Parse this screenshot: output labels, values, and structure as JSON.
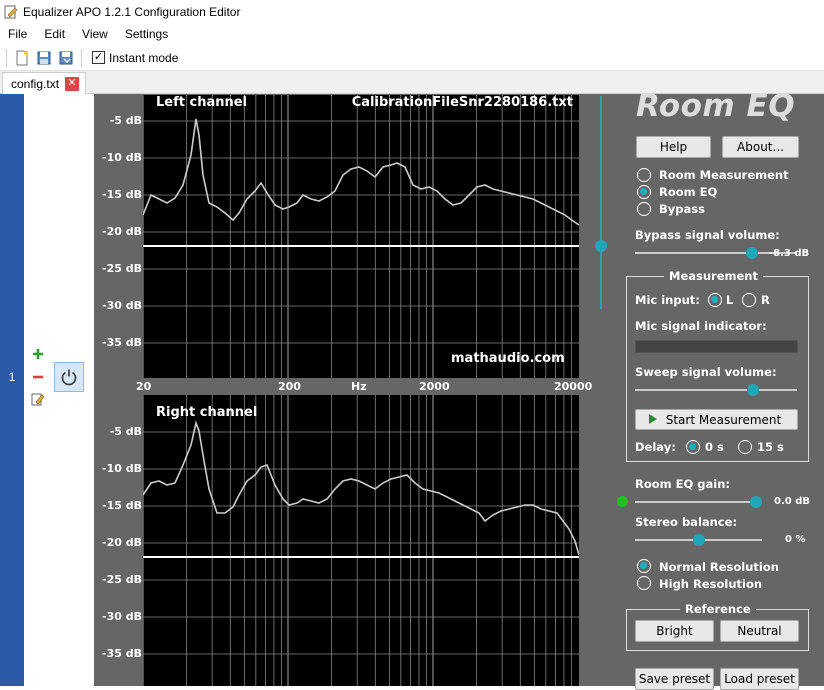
{
  "window": {
    "title": "Equalizer APO 1.2.1 Configuration Editor"
  },
  "menu": [
    "File",
    "Edit",
    "View",
    "Settings"
  ],
  "toolbar": {
    "instant_mode_label": "Instant mode",
    "instant_mode_checked": true
  },
  "tab": {
    "label": "config.txt"
  },
  "line": {
    "number": "1"
  },
  "graphs": {
    "top": {
      "label": "Left channel",
      "file": "CalibrationFileSnr2280186.txt",
      "watermark": "mathaudio.com"
    },
    "bottom": {
      "label": "Right channel"
    },
    "y_ticks": [
      "-5 dB",
      "-10 dB",
      "-15 dB",
      "-20 dB",
      "-25 dB",
      "-30 dB",
      "-35 dB"
    ],
    "x_ticks": [
      "20",
      "200",
      "Hz",
      "2000",
      "20000"
    ]
  },
  "roomeq": {
    "logo": "Room EQ",
    "help": "Help",
    "about": "About...",
    "modes": [
      "Room Measurement",
      "Room EQ",
      "Bypass"
    ],
    "mode_selected": 1,
    "bypass_label": "Bypass signal volume:",
    "bypass_value": "-8.3 dB",
    "bypass_level": 0.72,
    "measurement_title": "Measurement",
    "mic_input_label": "Mic input:",
    "mic_l": "L",
    "mic_r": "R",
    "mic_signal_label": "Mic signal indicator:",
    "sweep_label": "Sweep signal volume:",
    "sweep_level": 0.73,
    "start_label": "Start Measurement",
    "delay_label": "Delay:",
    "delay_0": "0 s",
    "delay_15": "15 s",
    "gain_label": "Room EQ gain:",
    "gain_value": "0.0 dB",
    "gain_level": 0.95,
    "stereo_label": "Stereo balance:",
    "stereo_value": "0 %",
    "stereo_level": 0.5,
    "normal_res": "Normal Resolution",
    "high_res": "High Resolution",
    "reference_title": "Reference",
    "bright": "Bright",
    "neutral": "Neutral",
    "save_preset": "Save preset",
    "load_preset": "Load preset"
  },
  "colors": {
    "accent": "#1fa7b8",
    "linebar": "#2a5aa8",
    "panel": "#666666"
  }
}
